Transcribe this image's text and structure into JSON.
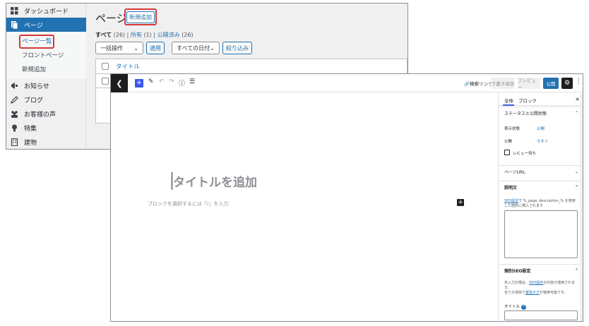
{
  "admin": {
    "sidebar": {
      "dashboard": "ダッシュボード",
      "pages": "ページ",
      "sub_list": "ページ一覧",
      "sub_front": "フロントページ",
      "sub_add": "新規追加",
      "news": "お知らせ",
      "blog": "ブログ",
      "voice": "お客様の声",
      "feature": "特集",
      "building": "建物"
    },
    "page_title": "ページ",
    "add_new": "新規追加",
    "filters": {
      "all": "すべて",
      "all_count": "(26)",
      "mine": "所有",
      "mine_count": "(1)",
      "published": "公開済み",
      "published_count": "(26)",
      "sep": "|"
    },
    "bulk_action": "一括操作",
    "apply": "適用",
    "all_dates": "すべての日付",
    "filter_btn": "絞り込み",
    "col_title": "タイトル",
    "accent": "#2271b1",
    "highlight": "#d63638"
  },
  "editor": {
    "toolbar": {
      "preview_link": "検索リンク",
      "save_draft": "下書き保存",
      "preview": "プレビュー",
      "publish": "公開"
    },
    "title_placeholder": "タイトルを追加",
    "block_placeholder": "ブロックを選択するには「/」を入力",
    "sidebar": {
      "tab_doc": "全体",
      "tab_block": "ブロック",
      "status_section": "ステータスと公開状態",
      "visibility_label": "表示状態",
      "visibility_value": "公開",
      "publish_label": "公開",
      "publish_value": "今すぐ",
      "pending_review": "レビュー待ち",
      "page_url": "ページURL",
      "description_section": "説明文",
      "description_link": "SEO設定",
      "description_text": "で %_page_description_% を使用した箇所に挿入されます",
      "seo_section": "個別SEO設定",
      "seo_text_1": "未入力の場合、",
      "seo_text_link": "SEO設定",
      "seo_text_2": "の内容が適用されます。",
      "seo_text_3": "全ての項目で",
      "seo_text_link2": "置換タグ",
      "seo_text_4": "が使用可能です。",
      "title_label": "タイトル",
      "help": "?"
    }
  }
}
